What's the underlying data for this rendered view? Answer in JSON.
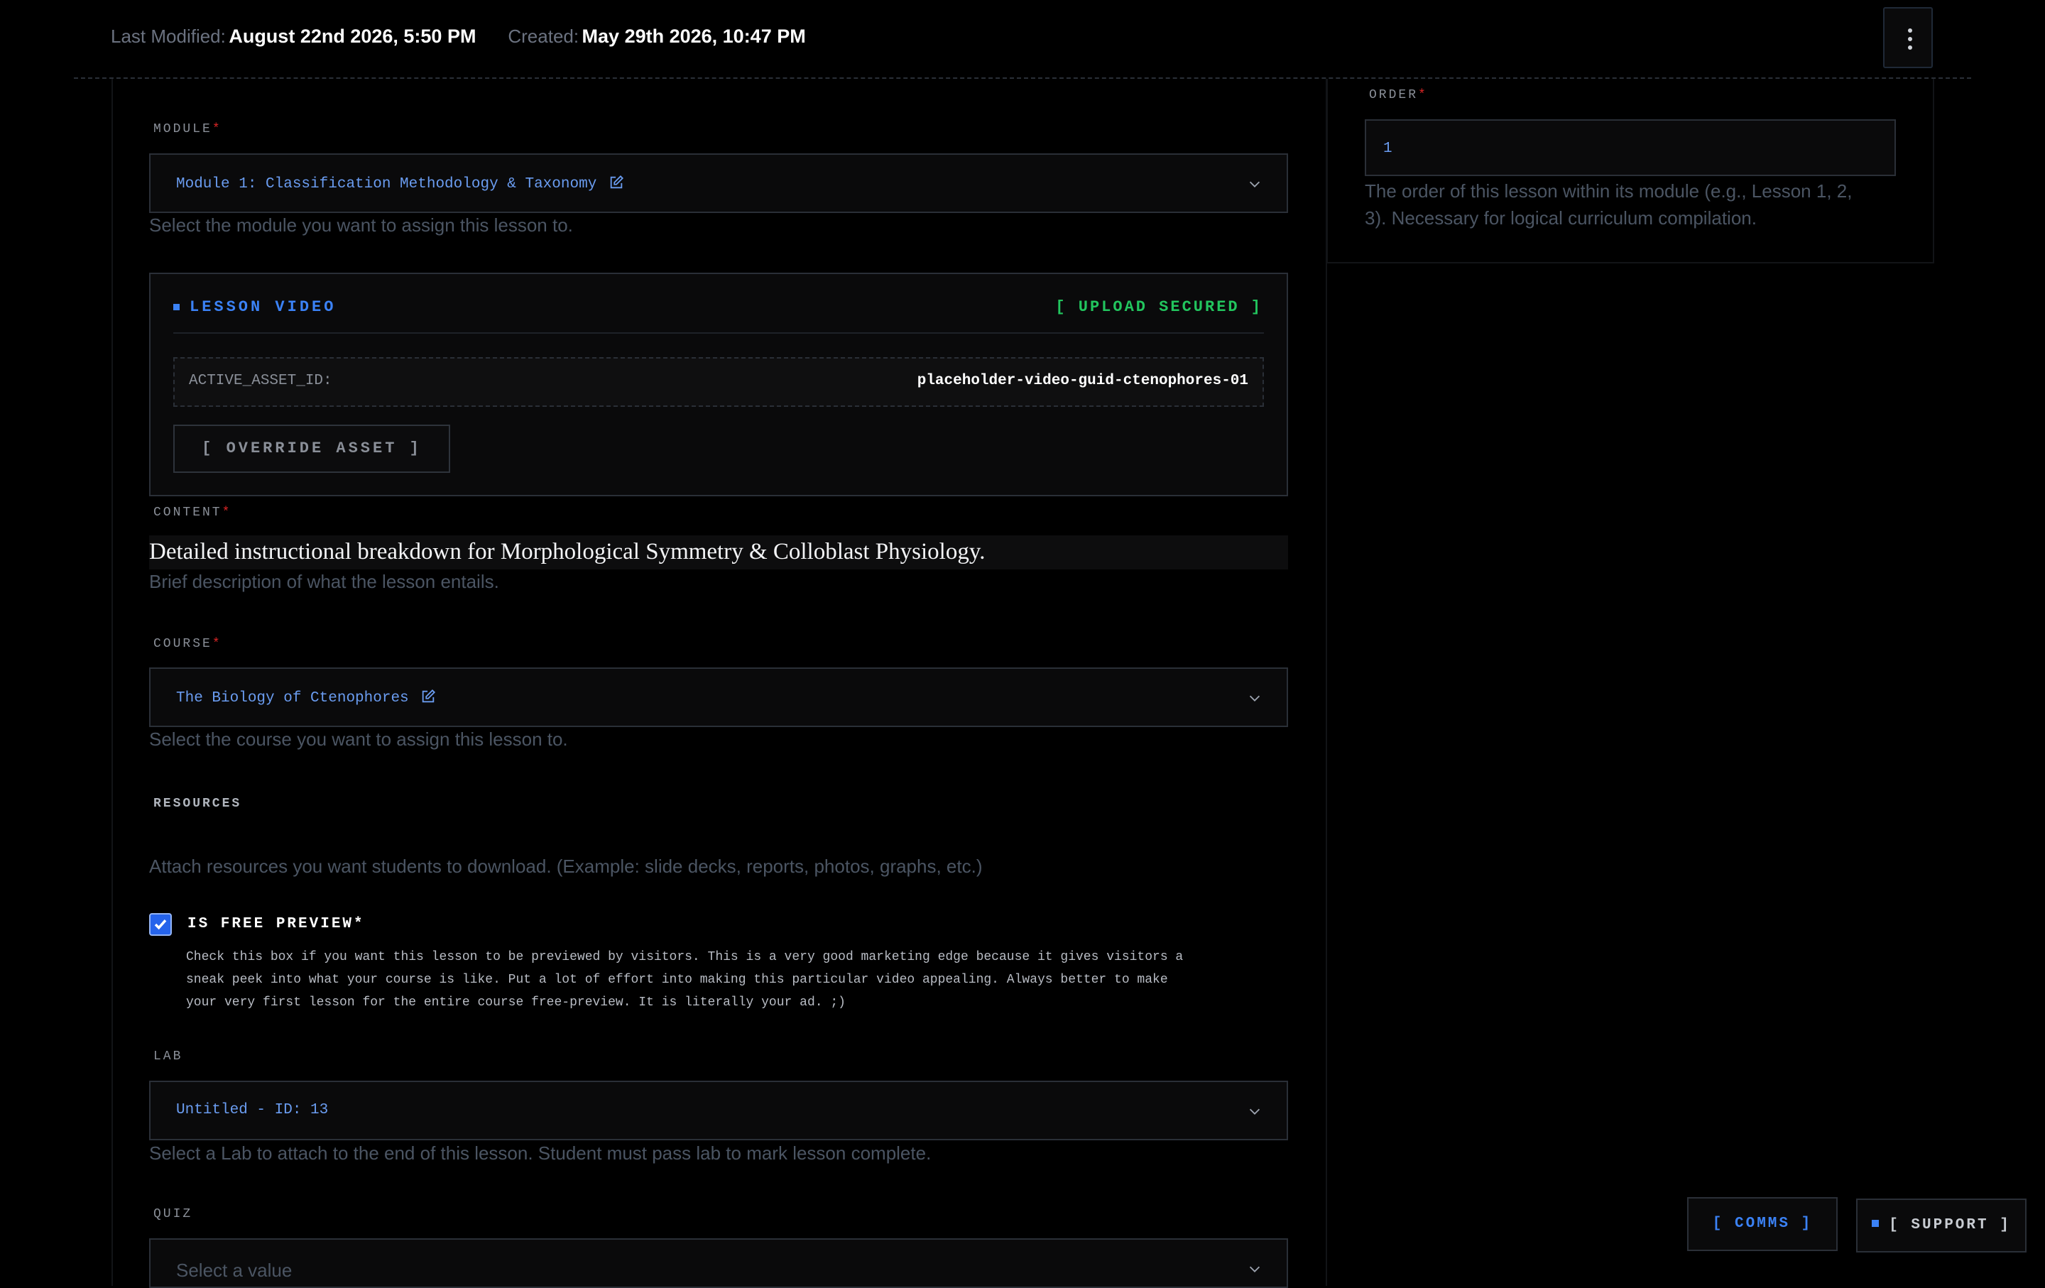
{
  "header": {
    "last_modified_label": "Last Modified:",
    "last_modified_value": "August 22nd 2026, 5:50 PM",
    "created_label": "Created:",
    "created_value": "May 29th 2026, 10:47 PM"
  },
  "module": {
    "label": "MODULE",
    "required_mark": "*",
    "value": "Module 1: Classification Methodology & Taxonomy",
    "help": "Select the module you want to assign this lesson to."
  },
  "lesson_video": {
    "title": "LESSON VIDEO",
    "status": "[ UPLOAD SECURED ]",
    "asset_label": "ACTIVE_ASSET_ID:",
    "asset_value": "placeholder-video-guid-ctenophores-01",
    "override_label": "[ OVERRIDE ASSET ]"
  },
  "content": {
    "label": "CONTENT",
    "required_mark": "*",
    "value": "Detailed instructional breakdown for Morphological Symmetry & Colloblast Physiology.",
    "help": "Brief description of what the lesson entails."
  },
  "course": {
    "label": "COURSE",
    "required_mark": "*",
    "value": "The Biology of Ctenophores",
    "help": "Select the course you want to assign this lesson to."
  },
  "resources": {
    "label": "RESOURCES",
    "help": "Attach resources you want students to download. (Example: slide decks, reports, photos, graphs, etc.)"
  },
  "free_preview": {
    "label": "IS FREE PREVIEW*",
    "checked": true,
    "description_lines": [
      "Check this box if you want this lesson to be previewed by visitors. This is a very good marketing edge because it gives visitors a",
      "sneak peek into what your course is like. Put a lot of effort into making this particular video appealing. Always better to make",
      "your very first lesson for the entire course free-preview. It is literally your ad. ;)"
    ]
  },
  "lab": {
    "label": "LAB",
    "value": "Untitled - ID: 13",
    "help": "Select a Lab to attach to the end of this lesson. Student must pass lab to mark lesson complete."
  },
  "quiz": {
    "label": "QUIZ",
    "placeholder": "Select a value"
  },
  "order": {
    "label": "ORDER",
    "required_mark": "*",
    "value": "1",
    "help_lines": [
      "The order of this lesson within its module (e.g., Lesson 1, 2,",
      "3). Necessary for logical curriculum compilation."
    ]
  },
  "floating": {
    "comms_label": "[ COMMS ]",
    "support_label": "[ SUPPORT ]"
  },
  "colors": {
    "background": "#000000",
    "accent_blue": "#3b82f6",
    "link_blue": "#6a9cf0",
    "success_green": "#22c55e",
    "required_red": "#dc2626"
  },
  "icons": {
    "menu": "vertical-dots-icon",
    "edit": "edit-icon",
    "chevron": "chevron-down-icon",
    "square_bullet": "square-bullet-icon",
    "check": "check-icon"
  }
}
